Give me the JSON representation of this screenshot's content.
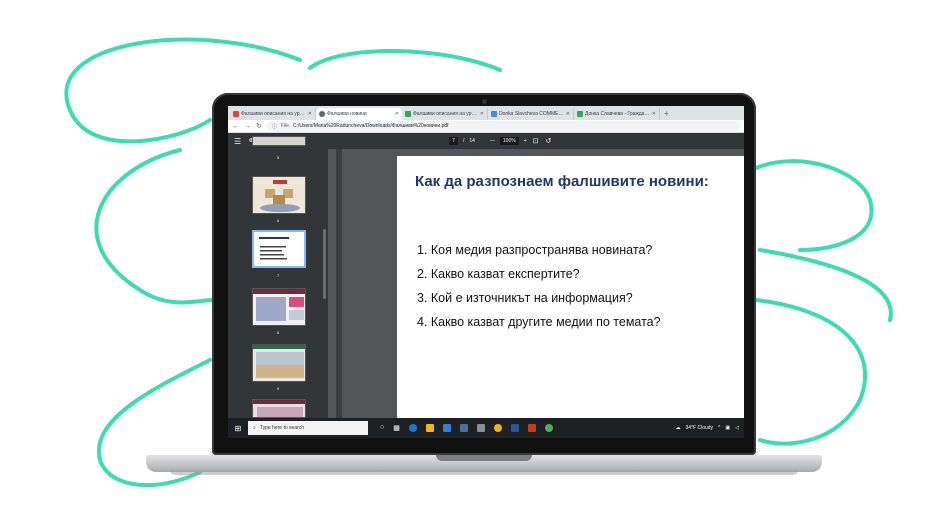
{
  "browser": {
    "tabs": [
      {
        "label": "Фалшиви описания на урочите",
        "favicon_color": "#ea4335",
        "active": false
      },
      {
        "label": "Фалшиви новини",
        "favicon_color": "#5f6368",
        "active": true
      },
      {
        "label": "Фалшиви описания на урочите",
        "favicon_color": "#34a853",
        "active": false
      },
      {
        "label": "Donka Slavcheva COMMENTS",
        "favicon_color": "#4285f4",
        "active": false
      },
      {
        "label": "Донка Славчева - Граждански",
        "favicon_color": "#34a853",
        "active": false
      }
    ],
    "new_tab": "+",
    "address": {
      "file_label": "File",
      "url": "C:/Users/Maria%20Raduncheva/Downloads/Фалшиви%20новини.pdf"
    }
  },
  "pdf_toolbar": {
    "title": "Фалшиви новини",
    "current_page": "7",
    "page_separator": "/",
    "total_pages": "14",
    "zoom_minus": "—",
    "zoom": "100%",
    "zoom_plus": "+"
  },
  "thumbnails": [
    {
      "number": "5"
    },
    {
      "number": "6"
    },
    {
      "number": "7",
      "selected": true
    },
    {
      "number": "8"
    },
    {
      "number": "9"
    }
  ],
  "slide": {
    "title": "Как да разпознаем фалшивите новини:",
    "questions": [
      "1. Коя медия разпространява новината?",
      "2. Какво казват експертите?",
      "3. Кой е източникът на информация?",
      "4. Какво казват другите медии по темата?"
    ]
  },
  "taskbar": {
    "search_placeholder": "Type here to search",
    "weather": "34°F Cloudy"
  },
  "colors": {
    "accent_scribble": "#3ddbb3",
    "slide_title": "#1f3864",
    "pdf_bar": "#323639"
  }
}
